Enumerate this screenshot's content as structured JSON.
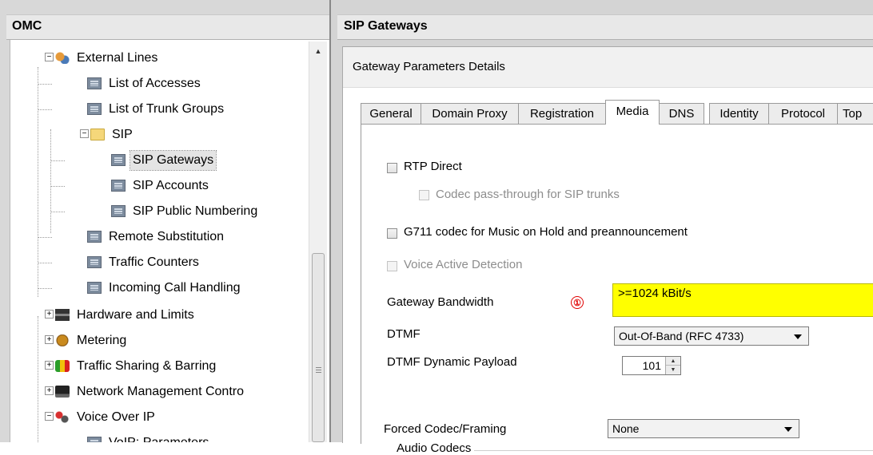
{
  "left_pane": {
    "title": "OMC",
    "tree": [
      {
        "label": "External Lines",
        "icon": "external-lines-icon",
        "expand": "minus"
      },
      {
        "label": "List of Accesses",
        "icon": "table-icon"
      },
      {
        "label": "List of Trunk Groups",
        "icon": "table-icon"
      },
      {
        "label": "SIP",
        "icon": "folder-icon",
        "expand": "minus"
      },
      {
        "label": "SIP Gateways",
        "icon": "table-icon",
        "selected": true
      },
      {
        "label": "SIP Accounts",
        "icon": "table-icon"
      },
      {
        "label": "SIP Public Numbering",
        "icon": "table-icon"
      },
      {
        "label": "Remote Substitution",
        "icon": "table-icon"
      },
      {
        "label": "Traffic Counters",
        "icon": "table-icon"
      },
      {
        "label": "Incoming Call Handling",
        "icon": "table-icon"
      },
      {
        "label": "Hardware and Limits",
        "icon": "hardware-icon",
        "expand": "plus"
      },
      {
        "label": "Metering",
        "icon": "metering-icon",
        "expand": "plus"
      },
      {
        "label": "Traffic Sharing & Barring",
        "icon": "traffic-light-icon",
        "expand": "plus"
      },
      {
        "label": "Network Management Contro",
        "icon": "network-icon",
        "expand": "plus"
      },
      {
        "label": "Voice Over IP",
        "icon": "voip-icon",
        "expand": "minus"
      },
      {
        "label": "VoIP: Parameters",
        "icon": "table-icon"
      }
    ]
  },
  "right_pane": {
    "title": "SIP Gateways",
    "dialog_title": "Gateway Parameters Details",
    "tabs": [
      "General",
      "Domain Proxy",
      "Registration",
      "Media",
      "DNS",
      "Identity",
      "Protocol",
      "Top"
    ],
    "active_tab": "Media",
    "media": {
      "rtp_direct": {
        "label": "RTP Direct",
        "checked": false,
        "enabled": true
      },
      "codec_passthrough": {
        "label": "Codec pass-through for SIP trunks",
        "checked": false,
        "enabled": false
      },
      "g711_moh": {
        "label": "G711 codec for Music on Hold and preannouncement",
        "checked": false,
        "enabled": true
      },
      "vad": {
        "label": "Voice Active Detection",
        "checked": false,
        "enabled": false
      },
      "gateway_bandwidth_label": "Gateway Bandwidth",
      "gateway_bandwidth_value": ">=1024 kBit/s",
      "marker": "①",
      "dtmf_label": "DTMF",
      "dtmf_value": "Out-Of-Band (RFC 4733)",
      "dtmf_payload_label": "DTMF Dynamic Payload",
      "dtmf_payload_value": "101",
      "audio_codecs_group": "Audio Codecs",
      "forced_codec_label": "Forced Codec/Framing",
      "forced_codec_value": "None"
    }
  },
  "colors": {
    "highlight": "#ffff00",
    "marker": "#e00000"
  }
}
